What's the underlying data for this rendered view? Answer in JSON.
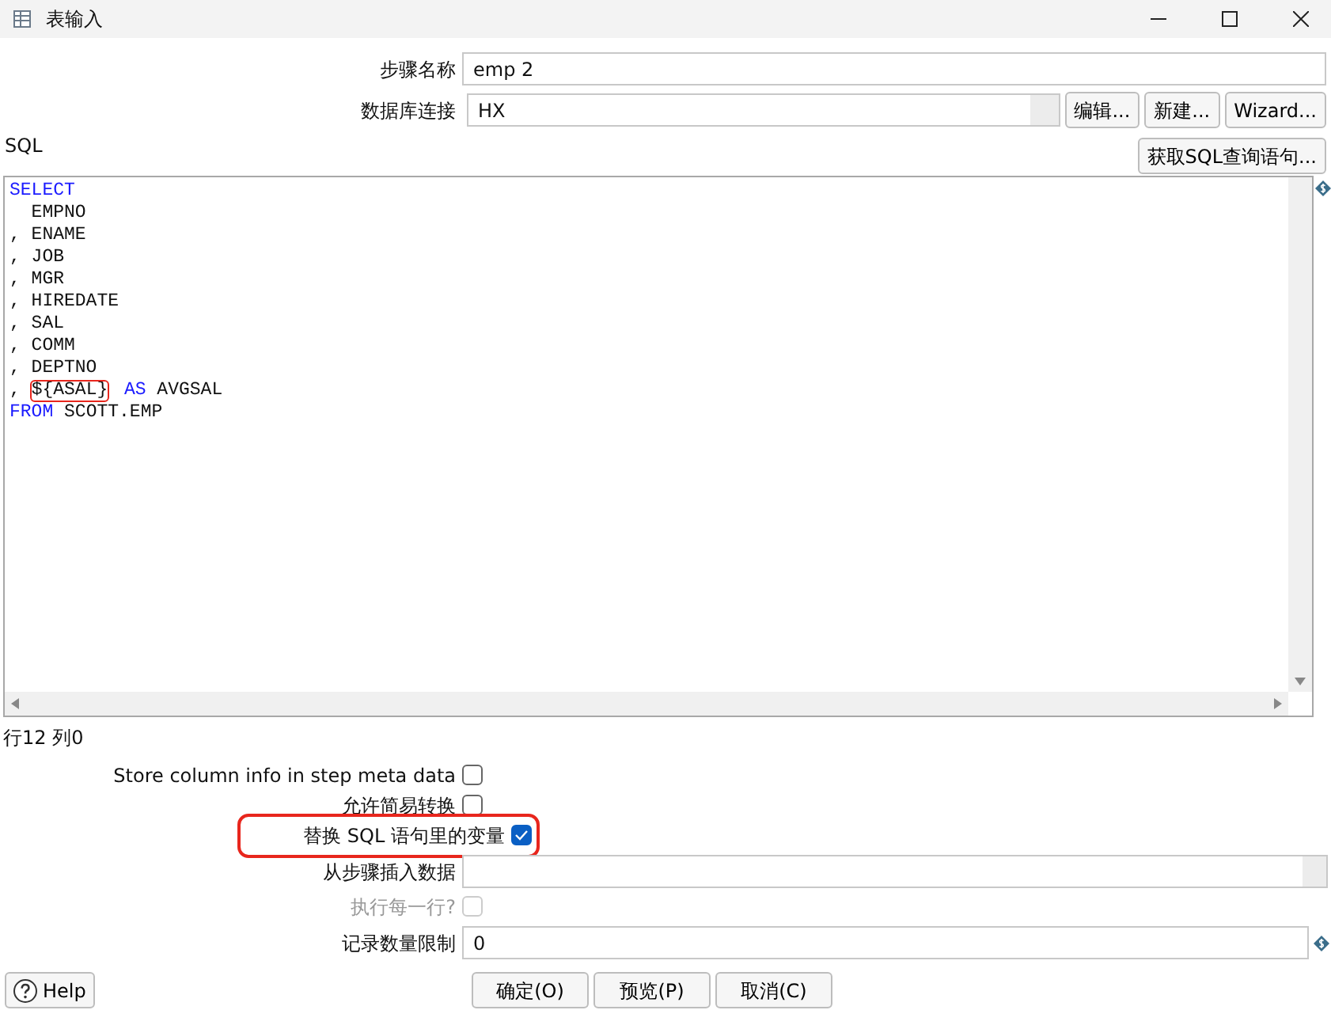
{
  "window": {
    "title": "表输入"
  },
  "step_name": {
    "label": "步骤名称",
    "value": "emp 2"
  },
  "connection": {
    "label": "数据库连接",
    "value": "HX",
    "buttons": [
      "编辑...",
      "新建...",
      "Wizard..."
    ]
  },
  "sql": {
    "label": "SQL",
    "fetch_button": "获取SQL查询语句...",
    "lines": [
      [
        {
          "text": "SELECT",
          "kind": "keyword"
        }
      ],
      [
        {
          "text": "  EMPNO",
          "kind": "plain"
        }
      ],
      [
        {
          "text": ", ENAME",
          "kind": "plain"
        }
      ],
      [
        {
          "text": ", JOB",
          "kind": "plain"
        }
      ],
      [
        {
          "text": ", MGR",
          "kind": "plain"
        }
      ],
      [
        {
          "text": ", HIREDATE",
          "kind": "plain"
        }
      ],
      [
        {
          "text": ", SAL",
          "kind": "plain"
        }
      ],
      [
        {
          "text": ", COMM",
          "kind": "plain"
        }
      ],
      [
        {
          "text": ", DEPTNO",
          "kind": "plain"
        }
      ],
      [
        {
          "text": ", ",
          "kind": "plain"
        },
        {
          "text": "${ASAL}",
          "kind": "plain",
          "highlighted": true
        },
        {
          "text": "AS",
          "kind": "keyword"
        },
        {
          "text": " AVGSAL",
          "kind": "plain"
        }
      ],
      [
        {
          "text": "FROM",
          "kind": "keyword"
        },
        {
          "text": " SCOTT.EMP",
          "kind": "plain"
        }
      ]
    ]
  },
  "cursor_position": "行12 列0",
  "options": [
    {
      "label": "Store column info in step meta data",
      "checked": false,
      "disabled": false,
      "highlighted": false
    },
    {
      "label": "允许简易转换",
      "checked": false,
      "disabled": false,
      "highlighted": false
    },
    {
      "label": "替换 SQL 语句里的变量",
      "checked": true,
      "disabled": false,
      "highlighted": true
    }
  ],
  "insert_from_step": {
    "label": "从步骤插入数据"
  },
  "execute_each_row": {
    "label": "执行每一行?",
    "checked": false,
    "disabled": true
  },
  "limit": {
    "label": "记录数量限制",
    "value": "0"
  },
  "help_button": "Help",
  "buttons": [
    "确定(O)",
    "预览(P)",
    "取消(C)"
  ]
}
